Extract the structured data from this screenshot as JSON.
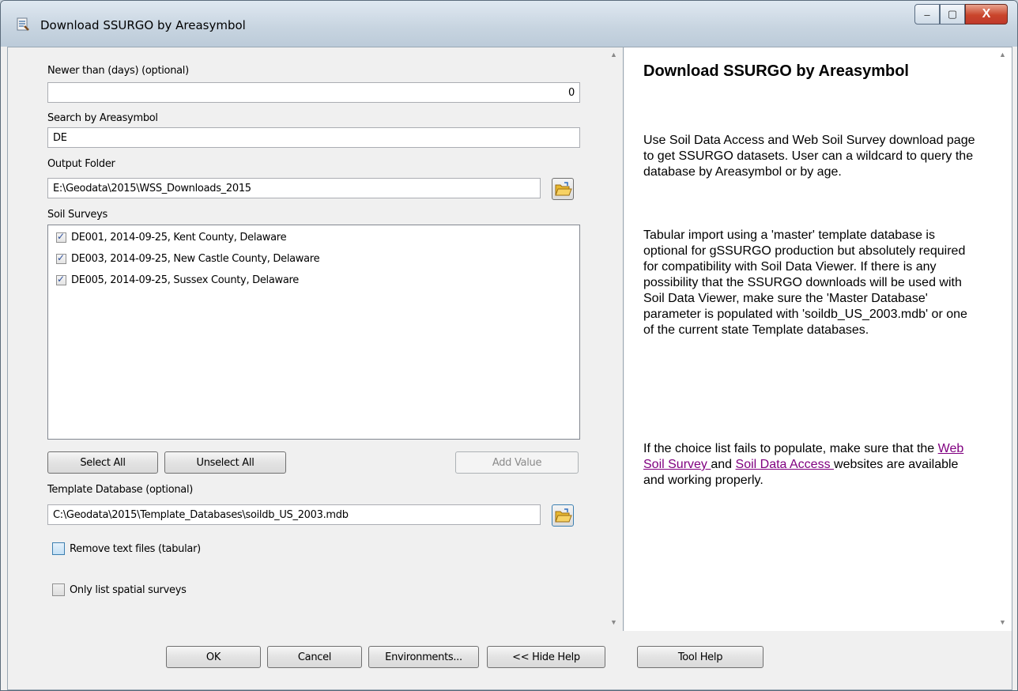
{
  "window": {
    "title": "Download SSURGO by Areasymbol",
    "minimize_glyph": "‒",
    "maximize_glyph": "▢",
    "close_glyph": "X"
  },
  "params": {
    "newer_label": "Newer than (days) (optional)",
    "newer_value": "0",
    "search_label": "Search by Areasymbol",
    "search_value": "DE",
    "output_label": "Output Folder",
    "output_value": "E:\\Geodata\\2015\\WSS_Downloads_2015",
    "surveys_label": "Soil Surveys",
    "surveys": [
      {
        "text": "DE001,  2014-09-25,  Kent County, Delaware",
        "checked": true
      },
      {
        "text": "DE003,  2014-09-25,  New Castle County, Delaware",
        "checked": true
      },
      {
        "text": "DE005,  2014-09-25,  Sussex County, Delaware",
        "checked": true
      }
    ],
    "select_all": "Select All",
    "unselect_all": "Unselect All",
    "add_value": "Add Value",
    "template_label": "Template Database (optional)",
    "template_value": "C:\\Geodata\\2015\\Template_Databases\\soildb_US_2003.mdb",
    "remove_text": "Remove text files (tabular)",
    "spatial_only": "Only list spatial surveys"
  },
  "help": {
    "title": "Download SSURGO by Areasymbol",
    "p1": "Use Soil Data Access and Web Soil Survey download page to get SSURGO datasets. User can a wildcard to query the database by Areasymbol or by age.",
    "p2": "Tabular import using a 'master' template database is optional for gSSURGO production but absolutely required for compatibility with Soil Data Viewer. If there is any possibility that the SSURGO downloads will be used with Soil Data Viewer, make sure the 'Master Database' parameter is populated with 'soildb_US_2003.mdb' or one of the current state Template databases.",
    "p3_before": "If the choice list fails to populate, make sure that the ",
    "link1": "Web Soil Survey ",
    "p3_mid": "and ",
    "link2": "Soil Data Access ",
    "p3_after": "websites are available and working properly."
  },
  "buttons": {
    "ok": "OK",
    "cancel": "Cancel",
    "environments": "Environments...",
    "hide_help": "<< Hide Help",
    "tool_help": "Tool Help"
  },
  "colors": {
    "link": "#800080",
    "close_button": "#c9452b"
  }
}
